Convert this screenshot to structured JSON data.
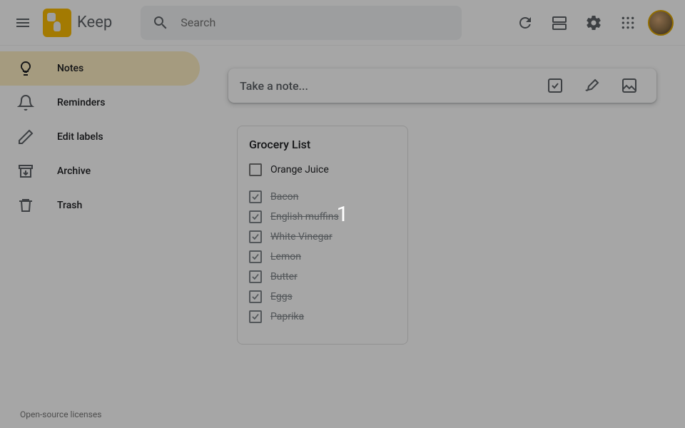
{
  "header": {
    "app_name": "Keep",
    "search_placeholder": "Search"
  },
  "sidebar": {
    "items": [
      {
        "label": "Notes",
        "active": true
      },
      {
        "label": "Reminders",
        "active": false
      },
      {
        "label": "Edit labels",
        "active": false
      },
      {
        "label": "Archive",
        "active": false
      },
      {
        "label": "Trash",
        "active": false
      }
    ],
    "footer": "Open-source licenses"
  },
  "compose": {
    "placeholder": "Take a note..."
  },
  "note": {
    "title": "Grocery List",
    "unchecked": [
      "Orange Juice"
    ],
    "checked": [
      "Bacon",
      "English muffins",
      "White Vinegar",
      "Lemon",
      "Butter",
      "Eggs",
      "Paprika"
    ]
  },
  "overlay": {
    "value": "1"
  }
}
